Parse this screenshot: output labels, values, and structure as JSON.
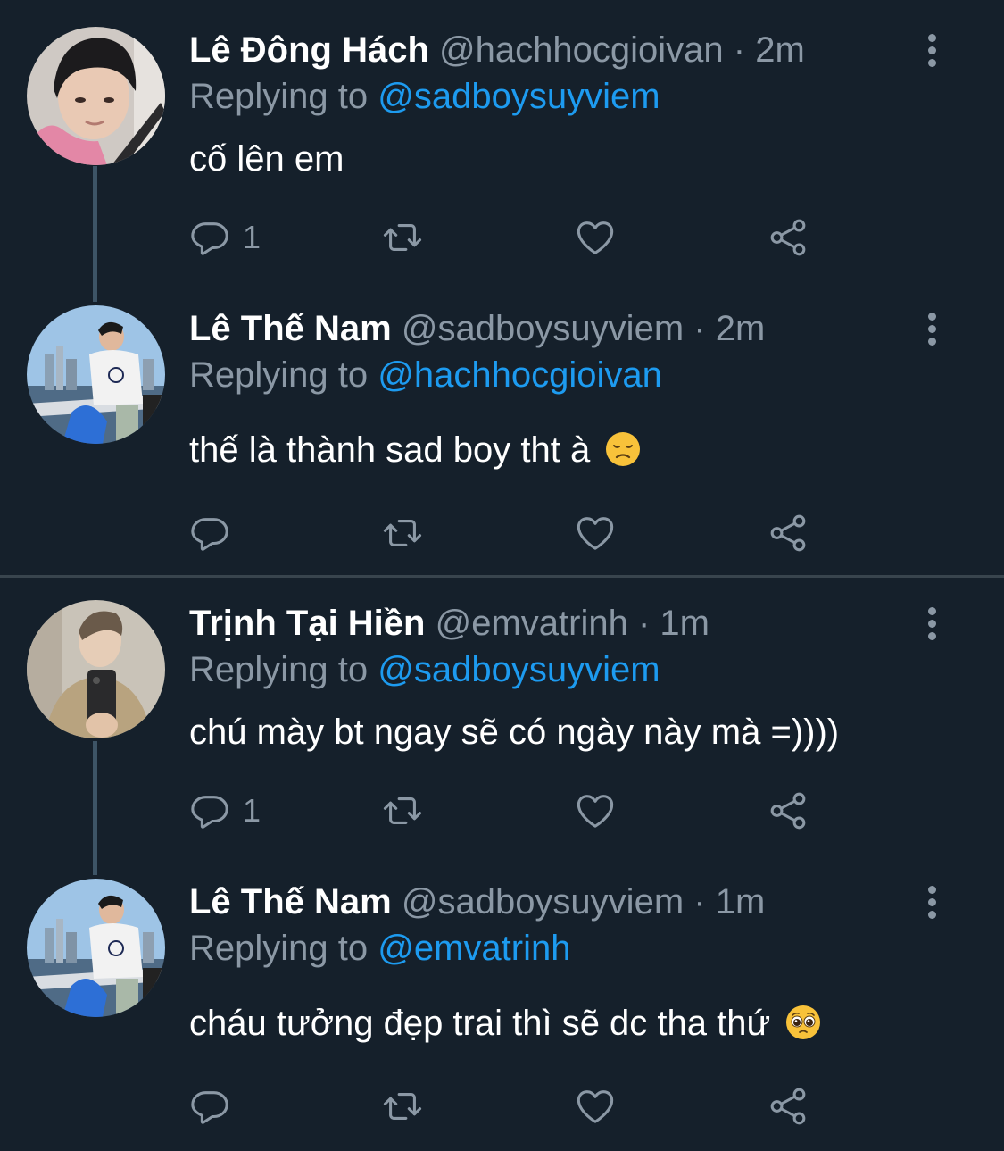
{
  "tweets": [
    {
      "name": "Lê Đông Hách",
      "handle": "@hachhocgioivan",
      "dot": "·",
      "time": "2m",
      "reply_prefix": "Replying to",
      "reply_to": "@sadboysuyviem",
      "text": "cố lên em",
      "emoji": "",
      "reply_count": "1",
      "avatar": "avatar-pink-hoodie"
    },
    {
      "name": "Lê Thế Nam",
      "handle": "@sadboysuyviem",
      "dot": "·",
      "time": "2m",
      "reply_prefix": "Replying to",
      "reply_to": "@hachhocgioivan",
      "text": "thế là thành sad boy tht à",
      "emoji": "disappointed-face-emoji",
      "reply_count": "",
      "avatar": "avatar-city-waterfront"
    },
    {
      "name": "Trịnh Tại Hiền",
      "handle": "@emvatrinh",
      "dot": "·",
      "time": "1m",
      "reply_prefix": "Replying to",
      "reply_to": "@sadboysuyviem",
      "text": "chú mày bt ngay sẽ có ngày này mà =))))",
      "emoji": "",
      "reply_count": "1",
      "avatar": "avatar-mirror-selfie"
    },
    {
      "name": "Lê Thế Nam",
      "handle": "@sadboysuyviem",
      "dot": "·",
      "time": "1m",
      "reply_prefix": "Replying to",
      "reply_to": "@emvatrinh",
      "text": "cháu tưởng đẹp trai thì sẽ dc tha thứ",
      "emoji": "pleading-face-emoji",
      "reply_count": "",
      "avatar": "avatar-city-waterfront"
    }
  ],
  "icons": {
    "reply": "reply-icon",
    "retweet": "retweet-icon",
    "like": "heart-icon",
    "share": "share-icon",
    "more": "more-options-icon"
  },
  "colors": {
    "background": "#15202b",
    "accent": "#1d9bf0",
    "muted": "#8b98a5",
    "divider": "#38444d",
    "thread": "#3d5466"
  }
}
